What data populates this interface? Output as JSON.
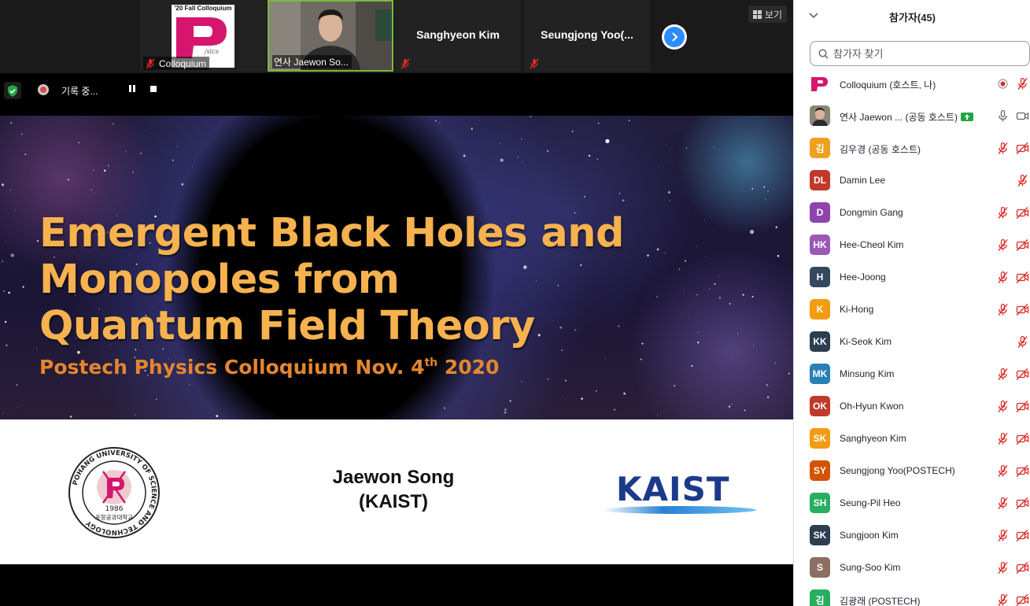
{
  "thumbnails": [
    {
      "name": "",
      "caption": "Colloquium",
      "logo_banner": "'20 Fall Colloquium",
      "muted": true
    },
    {
      "name": "",
      "caption": "연사 Jaewon So...",
      "muted": true,
      "active": true
    },
    {
      "name": "Sanghyeon Kim",
      "caption": "",
      "muted": true
    },
    {
      "name": "Seungjong  Yoo(...",
      "caption": "",
      "muted": true
    }
  ],
  "view_button_label": "보기",
  "recording": {
    "status_label": "기록 중..."
  },
  "slide": {
    "title_lines": [
      "Emergent Black Holes and",
      "Monopoles from",
      "Quantum Field Theory"
    ],
    "subtitle_main": "Postech Physics Colloquium Nov. 4",
    "subtitle_sup": "th",
    "subtitle_end": " 2020",
    "speaker_name": "Jaewon Song",
    "speaker_affiliation": "(KAIST)",
    "seal_text": "POHANG UNIVERSITY OF SCIENCE AND TECHNOLOGY",
    "seal_year": "1986",
    "seal_korean": "포항공과대학교",
    "kaist_logo": "KAIST"
  },
  "panel": {
    "title": "참가자(45)",
    "search_placeholder": "참가자 찾기",
    "participants": [
      {
        "initials": "P",
        "color": "#ffffff",
        "name": "Colloquium (호스트, 나)",
        "icons": [
          "rec",
          "mic-off"
        ],
        "avatar_type": "postech"
      },
      {
        "initials": "",
        "color": "#777777",
        "name": "연사 Jaewon ...  (공동 호스트)",
        "icons": [
          "mic-on",
          "cam-on"
        ],
        "avatar_type": "photo",
        "sharing": true
      },
      {
        "initials": "김",
        "color": "#f0a020",
        "name": "김우경 (공동 호스트)",
        "icons": [
          "mic-off",
          "cam-off"
        ]
      },
      {
        "initials": "DL",
        "color": "#c0392b",
        "name": "Damin Lee",
        "icons": [
          "mic-off"
        ]
      },
      {
        "initials": "D",
        "color": "#8e44ad",
        "name": "Dongmin Gang",
        "icons": [
          "mic-off",
          "cam-off"
        ]
      },
      {
        "initials": "HK",
        "color": "#9b59b6",
        "name": "Hee-Cheol Kim",
        "icons": [
          "mic-off",
          "cam-off"
        ]
      },
      {
        "initials": "H",
        "color": "#34495e",
        "name": "Hee-Joong",
        "icons": [
          "mic-off",
          "cam-off"
        ]
      },
      {
        "initials": "K",
        "color": "#f39c12",
        "name": "Ki-Hong",
        "icons": [
          "mic-off",
          "cam-off"
        ]
      },
      {
        "initials": "KK",
        "color": "#2c3e50",
        "name": "Ki-Seok Kim",
        "icons": [
          "mic-off"
        ]
      },
      {
        "initials": "MK",
        "color": "#2980b9",
        "name": "Minsung Kim",
        "icons": [
          "mic-off",
          "cam-off"
        ]
      },
      {
        "initials": "OK",
        "color": "#c0392b",
        "name": "Oh-Hyun Kwon",
        "icons": [
          "mic-off",
          "cam-off"
        ]
      },
      {
        "initials": "SK",
        "color": "#f39c12",
        "name": "Sanghyeon Kim",
        "icons": [
          "mic-off",
          "cam-off"
        ]
      },
      {
        "initials": "SY",
        "color": "#d35400",
        "name": "Seungjong Yoo(POSTECH)",
        "icons": [
          "mic-off",
          "cam-off"
        ]
      },
      {
        "initials": "SH",
        "color": "#27ae60",
        "name": "Seung-Pil Heo",
        "icons": [
          "mic-off",
          "cam-off"
        ]
      },
      {
        "initials": "SK",
        "color": "#2c3e50",
        "name": "Sungjoon Kim",
        "icons": [
          "mic-off",
          "cam-off"
        ]
      },
      {
        "initials": "S",
        "color": "#8d6e63",
        "name": "Sung-Soo Kim",
        "icons": [
          "mic-off",
          "cam-off"
        ]
      },
      {
        "initials": "김",
        "color": "#27ae60",
        "name": "김광래 (POSTECH)",
        "icons": [
          "mic-off",
          "cam-off"
        ]
      }
    ]
  },
  "colors": {
    "accent_blue": "#2d8cff",
    "mute_red": "#e02828",
    "slide_title": "#f6b24e",
    "slide_sub": "#e3862e",
    "active_border": "#7cba3a"
  }
}
